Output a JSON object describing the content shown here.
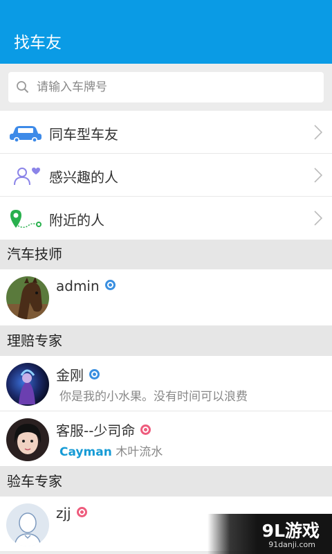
{
  "header": {
    "title": "找车友"
  },
  "search": {
    "placeholder": "请输入车牌号",
    "icon": "search-icon"
  },
  "menu": [
    {
      "label": "同车型车友",
      "icon": "car-icon",
      "color": "#3d8ae8"
    },
    {
      "label": "感兴趣的人",
      "icon": "interested-person-icon",
      "color": "#8b84e8"
    },
    {
      "label": "附近的人",
      "icon": "location-pin-icon",
      "color": "#28b04d"
    }
  ],
  "sections": [
    {
      "title": "汽车技师",
      "people": [
        {
          "name": "admin",
          "gender": "male"
        }
      ]
    },
    {
      "title": "理赔专家",
      "people": [
        {
          "name": "金刚",
          "gender": "male",
          "subtitle": "你是我的小水果。没有时间可以浪费"
        },
        {
          "name": "客服--少司命",
          "gender": "female",
          "sub_bold": "Cayman",
          "sub_rest": "木叶流水"
        }
      ]
    },
    {
      "title": "验车专家",
      "people": [
        {
          "name": "zjj",
          "gender": "female"
        }
      ]
    }
  ],
  "watermark": {
    "main": "9L游戏",
    "sub": "91danji.com"
  },
  "colors": {
    "header": "#0a9be5",
    "accent": "#169bd5",
    "male": "#3a8fe0",
    "female": "#ee5c7d"
  }
}
